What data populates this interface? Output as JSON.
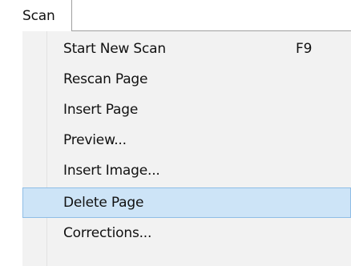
{
  "menubar": {
    "scan_label": "Scan"
  },
  "scan_menu": {
    "items": [
      {
        "label": "Start New Scan",
        "shortcut": "F9"
      },
      {
        "label": "Rescan Page",
        "shortcut": ""
      },
      {
        "label": "Insert Page",
        "shortcut": ""
      },
      {
        "label": "Preview...",
        "shortcut": ""
      },
      {
        "label": "Insert Image...",
        "shortcut": ""
      },
      {
        "label": "Delete Page",
        "shortcut": "",
        "highlighted": true
      },
      {
        "label": "Corrections...",
        "shortcut": ""
      }
    ]
  },
  "colors": {
    "highlight_fill": "#cde4f7",
    "highlight_border": "#8fbde6",
    "menu_background": "#f2f2f2"
  }
}
